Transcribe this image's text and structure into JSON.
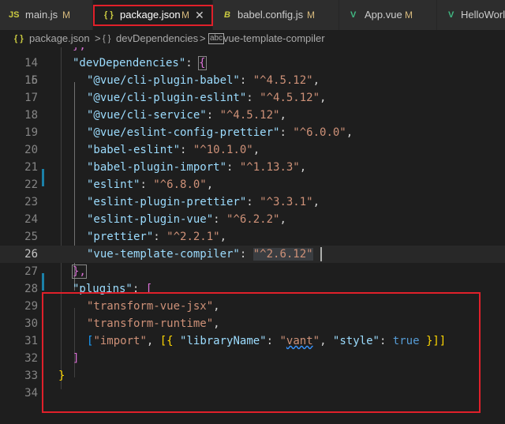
{
  "tabs": [
    {
      "icon": "JS",
      "label": "main.js",
      "modified": "M"
    },
    {
      "icon": "{ }",
      "label": "package.json",
      "modified": "M",
      "close": "✕"
    },
    {
      "icon": "B",
      "label": "babel.config.js",
      "modified": "M"
    },
    {
      "icon": "V",
      "label": "App.vue",
      "modified": "M"
    },
    {
      "icon": "V",
      "label": "HelloWorl"
    }
  ],
  "breadcrumb": {
    "file_icon": "{ }",
    "file": "package.json",
    "sep1": ">",
    "key_icon": "{ }",
    "key": "devDependencies",
    "sep2": ">",
    "leaf_icon": "abc",
    "leaf": "vue-template-compiler"
  },
  "editor": {
    "line_numbers": [
      "14",
      "15",
      "16",
      "17",
      "18",
      "19",
      "20",
      "21",
      "22",
      "23",
      "24",
      "25",
      "26",
      "27",
      "28",
      "29",
      "30",
      "31",
      "32",
      "33",
      "34"
    ],
    "lines": {
      "l14": "},",
      "l15_key": "\"devDependencies\"",
      "l15_sep": ": ",
      "l15_brace": "{",
      "l16_key": "\"@vue/cli-plugin-babel\"",
      "l16_val": "\"^4.5.12\"",
      "l17_key": "\"@vue/cli-plugin-eslint\"",
      "l17_val": "\"^4.5.12\"",
      "l18_key": "\"@vue/cli-service\"",
      "l18_val": "\"^4.5.12\"",
      "l19_key": "\"@vue/eslint-config-prettier\"",
      "l19_val": "\"^6.0.0\"",
      "l20_key": "\"babel-eslint\"",
      "l20_val": "\"^10.1.0\"",
      "l21_key": "\"babel-plugin-import\"",
      "l21_val": "\"^1.13.3\"",
      "l22_key": "\"eslint\"",
      "l22_val": "\"^6.8.0\"",
      "l23_key": "\"eslint-plugin-prettier\"",
      "l23_val": "\"^3.3.1\"",
      "l24_key": "\"eslint-plugin-vue\"",
      "l24_val": "\"^6.2.2\"",
      "l25_key": "\"prettier\"",
      "l25_val": "\"^2.2.1\"",
      "l26_key": "\"vue-template-compiler\"",
      "l26_val": "\"^2.6.12\"",
      "l27": "},",
      "l28_key": "\"plugins\"",
      "l28_bracket": "[",
      "l29_val": "\"transform-vue-jsx\"",
      "l30_val": "\"transform-runtime\"",
      "l31_open": "[",
      "l31_import": "\"import\"",
      "l31_obj_open": "[{",
      "l31_lib_key": "\"libraryName\"",
      "l31_lib_val_q1": "\"",
      "l31_lib_val": "vant",
      "l31_lib_val_q2": "\"",
      "l31_style_key": "\"style\"",
      "l31_true": "true",
      "l31_close": "}]]",
      "l32": "]",
      "l33": "}",
      "colon": ": ",
      "comma": ","
    }
  },
  "colors": {
    "accent_box": "#e0202a",
    "modified": "#d7ba7d",
    "key": "#9cdcfe",
    "string": "#ce9178"
  }
}
